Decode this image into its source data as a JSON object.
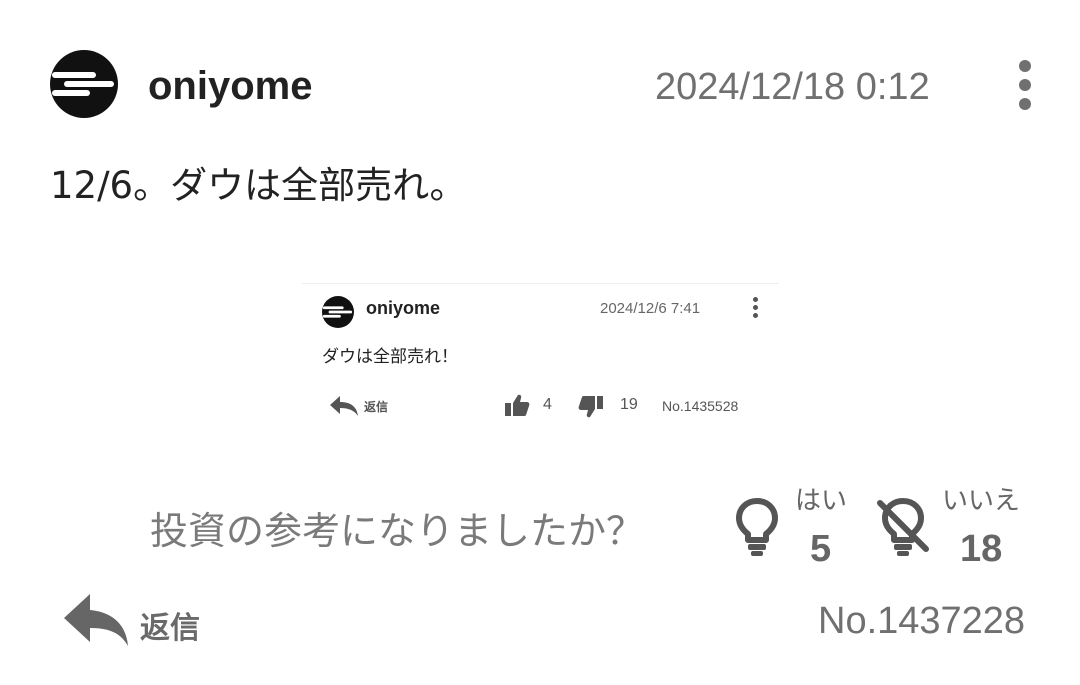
{
  "post": {
    "username": "oniyome",
    "timestamp": "2024/12/18 0:12",
    "text": "12/6。ダウは全部売れ。",
    "avatar_icon": "oniyome-logo-icon",
    "menu_icon": "more-vert-icon",
    "number": "No.1437228"
  },
  "embedded_post": {
    "username": "oniyome",
    "timestamp": "2024/12/6 7:41",
    "text": "ダウは全部売れ！",
    "reply_label": "返信",
    "thumbs_up_count": "4",
    "thumbs_down_count": "19",
    "number": "No.1435528"
  },
  "feedback": {
    "question": "投資の参考になりましたか？",
    "yes_label": "はい",
    "yes_count": "5",
    "no_label": "いいえ",
    "no_count": "18",
    "yes_icon": "lightbulb-icon",
    "no_icon": "lightbulb-off-icon"
  },
  "footer": {
    "reply_label": "返信",
    "reply_icon": "reply-arrow-icon"
  },
  "colors": {
    "text": "#222222",
    "muted": "#707070",
    "icon": "#555555"
  }
}
